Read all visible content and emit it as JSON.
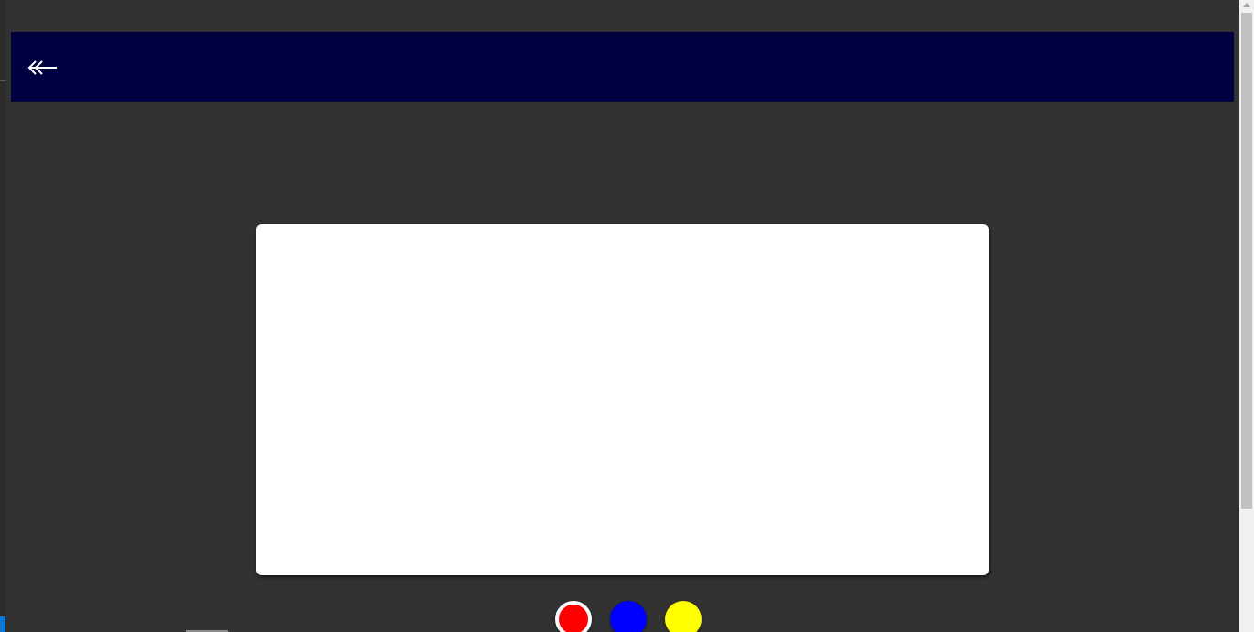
{
  "header": {
    "back_icon": "double-arrow-left-icon",
    "background": "#000040"
  },
  "canvas": {
    "background": "#ffffff"
  },
  "palette": {
    "swatches": [
      {
        "name": "red",
        "color": "#ff0000",
        "selected": true
      },
      {
        "name": "blue",
        "color": "#0000ff",
        "selected": false
      },
      {
        "name": "yellow",
        "color": "#ffff00",
        "selected": false
      }
    ]
  },
  "colors": {
    "page_background": "#323232",
    "accent": "#0a78d4"
  }
}
